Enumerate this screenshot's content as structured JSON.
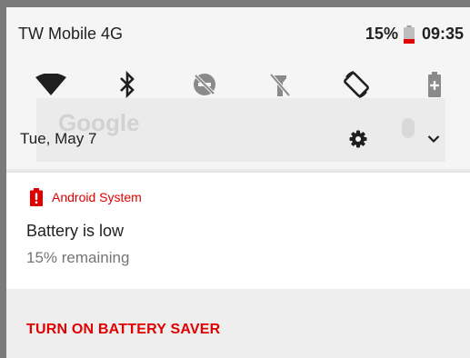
{
  "status_bar": {
    "carrier": "TW Mobile 4G",
    "battery_percent": "15%",
    "time": "09:35"
  },
  "quick_settings": [
    {
      "name": "wifi-icon",
      "state": "on"
    },
    {
      "name": "bluetooth-icon",
      "state": "on"
    },
    {
      "name": "do-not-disturb-off-icon",
      "state": "off"
    },
    {
      "name": "flashlight-off-icon",
      "state": "off"
    },
    {
      "name": "auto-rotate-icon",
      "state": "on"
    },
    {
      "name": "battery-saver-icon",
      "state": "off"
    }
  ],
  "background": {
    "search_hint": "Google"
  },
  "header": {
    "date": "Tue, May 7"
  },
  "notification": {
    "app_name": "Android System",
    "title": "Battery is low",
    "text": "15% remaining",
    "action": "TURN ON BATTERY SAVER"
  },
  "colors": {
    "accent": "#e10000",
    "text_primary": "#212121",
    "text_secondary": "#757575"
  }
}
